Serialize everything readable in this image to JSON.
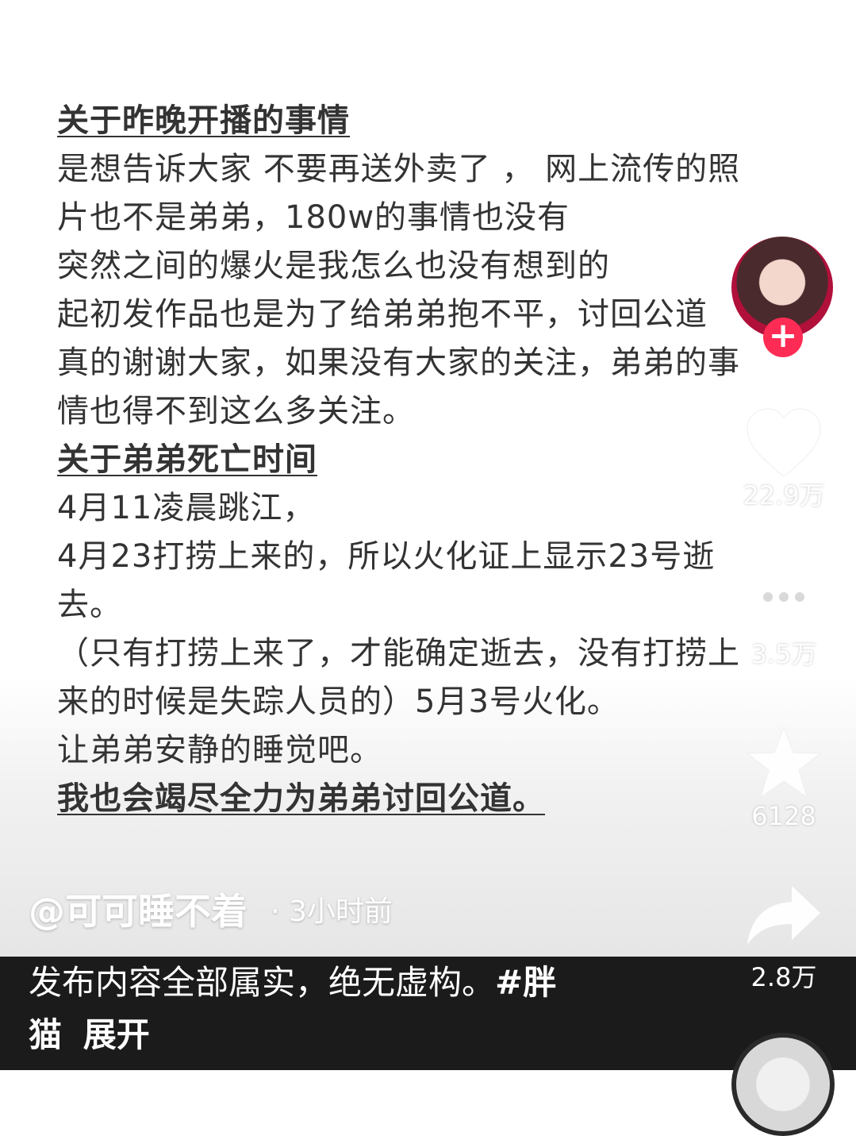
{
  "post_lines": [
    {
      "text": "关于昨晚开播的事情",
      "style": "heading"
    },
    {
      "text": "是想告诉大家 不要再送外卖了 ， 网上流传的照",
      "style": "body"
    },
    {
      "text": "片也不是弟弟，180w的事情也没有",
      "style": "body"
    },
    {
      "text": "突然之间的爆火是我怎么也没有想到的",
      "style": "body"
    },
    {
      "text": "起初发作品也是为了给弟弟抱不平，讨回公道",
      "style": "body"
    },
    {
      "text": "真的谢谢大家，如果没有大家的关注，弟弟的事",
      "style": "body"
    },
    {
      "text": "情也得不到这么多关注。",
      "style": "body"
    },
    {
      "text": "关于弟弟死亡时间",
      "style": "heading"
    },
    {
      "text": "4月11凌晨跳江，",
      "style": "body"
    },
    {
      "text": "4月23打捞上来的，所以火化证上显示23号逝",
      "style": "body"
    },
    {
      "text": "去。",
      "style": "body"
    },
    {
      "text": "（只有打捞上来了，才能确定逝去，没有打捞上",
      "style": "body"
    },
    {
      "text": "来的时候是失踪人员的）5月3号火化。",
      "style": "body"
    },
    {
      "text": "让弟弟安静的睡觉吧。",
      "style": "body"
    },
    {
      "text": "我也会竭尽全力为弟弟讨回公道。",
      "style": "heading"
    }
  ],
  "actions": {
    "like_count": "22.9万",
    "comment_count": "3.5万",
    "favorite_count": "6128",
    "share_count": "2.8万"
  },
  "author": {
    "name": "@可可睡不着",
    "time": "· 3小时前"
  },
  "caption": {
    "text": "发布内容全部属实，绝无虚构。",
    "hashtag": "#胖猫",
    "expand": "展开"
  },
  "icons": {
    "follow": "plus-icon",
    "like": "heart-icon",
    "comment": "comment-icon",
    "favorite": "star-icon",
    "share": "share-icon"
  },
  "colors": {
    "follow_button": "#fe2c55",
    "bottom_bar": "#1b1b1b"
  }
}
